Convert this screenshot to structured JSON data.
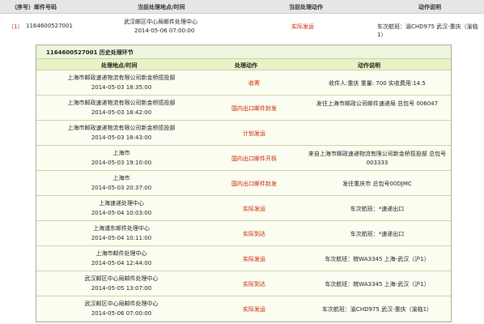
{
  "header": {
    "col_id": "（序号）邮件号码",
    "col_loc": "当前处理地点/时间",
    "col_act": "当前处理动作",
    "col_desc": "动作说明"
  },
  "summary": {
    "index": "（1）",
    "mail_no": "1164600527001",
    "loc": "武汉邮区中心局邮件处理中心",
    "time": "2014-05-06 07:00:00",
    "act": "实际发运",
    "desc": "车次航班：渝CHD975 武汉-重庆（渝临1）"
  },
  "history": {
    "title": "1164600527001  历史处理环节",
    "col_loc": "处理地点/时间",
    "col_act": "处理动作",
    "col_desc": "动作说明",
    "rows": [
      {
        "loc": "上海市邮政速递物流有限公司新金桥揽投部",
        "time": "2014-05-03 18:35:00",
        "act": "收寄",
        "desc": "收件人:重庆 重量: 700 实收费用:14.5"
      },
      {
        "loc": "上海市邮政速递物流有限公司新金桥揽投部",
        "time": "2014-05-03 18:42:00",
        "act": "国内出口邮件封发",
        "desc": "发往上海市邮政公司邮件速递局 总包号 006047"
      },
      {
        "loc": "上海市邮政速递物流有限公司新金桥揽投部",
        "time": "2014-05-03 18:43:00",
        "act": "计划发运",
        "desc": ""
      },
      {
        "loc": "上海市",
        "time": "2014-05-03 19:10:00",
        "act": "国内出口邮件开拆",
        "desc": "来自上海市邮政速递物流有限公司新金桥揽投部 总包号003333"
      },
      {
        "loc": "上海市",
        "time": "2014-05-03 20:37:00",
        "act": "国内出口邮件封发",
        "desc": "发往重庆市 总包号00DJMC"
      },
      {
        "loc": "上海速递处理中心",
        "time": "2014-05-04 10:03:00",
        "act": "实际发运",
        "desc": "车次航班：*速递出口"
      },
      {
        "loc": "上海浦东邮件处理中心",
        "time": "2014-05-04 10:11:00",
        "act": "实际到达",
        "desc": "车次航班：*速递出口"
      },
      {
        "loc": "上海市邮件处理中心",
        "time": "2014-05-04 12:44:00",
        "act": "实际发运",
        "desc": "车次航班：皖WA3345 上海-武汉（沪1）"
      },
      {
        "loc": "武汉邮区中心局邮件处理中心",
        "time": "2014-05-05 13:07:00",
        "act": "实际到达",
        "desc": "车次航班：皖WA3345 上海-武汉（沪1）"
      },
      {
        "loc": "武汉邮区中心局邮件处理中心",
        "time": "2014-05-06 07:00:00",
        "act": "实际发运",
        "desc": "车次航班：渝CHD975 武汉-重庆（渝临1）"
      }
    ]
  }
}
